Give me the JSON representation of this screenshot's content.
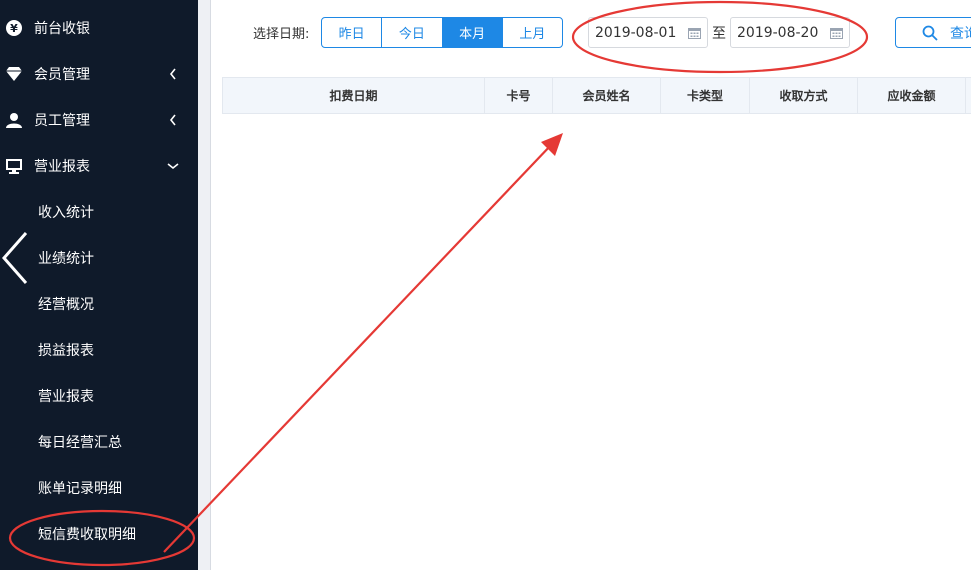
{
  "sidebar": {
    "items": [
      {
        "label": "前台收银",
        "icon": "yen-icon"
      },
      {
        "label": "会员管理",
        "icon": "diamond-icon"
      },
      {
        "label": "员工管理",
        "icon": "user-icon"
      },
      {
        "label": "营业报表",
        "icon": "monitor-icon"
      }
    ],
    "sub_items": [
      {
        "label": "收入统计"
      },
      {
        "label": "业绩统计"
      },
      {
        "label": "经营概况"
      },
      {
        "label": "损益报表"
      },
      {
        "label": "营业报表"
      },
      {
        "label": "每日经营汇总"
      },
      {
        "label": "账单记录明细"
      },
      {
        "label": "短信费收取明细"
      }
    ]
  },
  "toolbar": {
    "date_label": "选择日期:",
    "segments": [
      {
        "label": "昨日"
      },
      {
        "label": "今日"
      },
      {
        "label": "本月",
        "active": true
      },
      {
        "label": "上月"
      }
    ],
    "start_date": "2019-08-01",
    "to_label": "至",
    "end_date": "2019-08-20",
    "query_label": "查询"
  },
  "table": {
    "columns": [
      "扣费日期",
      "卡号",
      "会员姓名",
      "卡类型",
      "收取方式",
      "应收金额"
    ]
  },
  "colors": {
    "sidebar_bg": "#0f1a2a",
    "accent": "#1e88e5",
    "annotation": "#e53935"
  }
}
